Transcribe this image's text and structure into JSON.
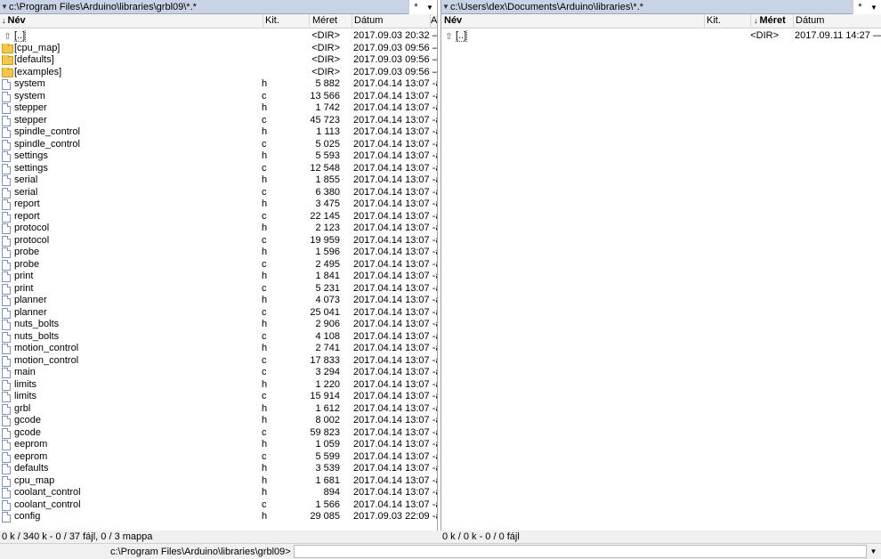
{
  "left": {
    "path": "c:\\Program Files\\Arduino\\libraries\\grbl09\\*.*",
    "headers": {
      "name": "Név",
      "ext": "Kit.",
      "size": "Méret",
      "date": "Dátum",
      "attr": "A"
    },
    "files": [
      {
        "icon": "up-icon",
        "name": "[..]",
        "ext": "",
        "size": "<DIR>",
        "date": "2017.09.03 20:32 —"
      },
      {
        "icon": "folder-icon",
        "name": "[cpu_map]",
        "ext": "",
        "size": "<DIR>",
        "date": "2017.09.03 09:56 —"
      },
      {
        "icon": "folder-icon",
        "name": "[defaults]",
        "ext": "",
        "size": "<DIR>",
        "date": "2017.09.03 09:56 —"
      },
      {
        "icon": "folder-icon",
        "name": "[examples]",
        "ext": "",
        "size": "<DIR>",
        "date": "2017.09.03 09:56 —"
      },
      {
        "icon": "file-icon",
        "name": "system",
        "ext": "h",
        "size": "5 882",
        "date": "2017.04.14 13:07 -a"
      },
      {
        "icon": "file-icon",
        "name": "system",
        "ext": "c",
        "size": "13 566",
        "date": "2017.04.14 13:07 -a"
      },
      {
        "icon": "file-icon",
        "name": "stepper",
        "ext": "h",
        "size": "1 742",
        "date": "2017.04.14 13:07 -a"
      },
      {
        "icon": "file-icon",
        "name": "stepper",
        "ext": "c",
        "size": "45 723",
        "date": "2017.04.14 13:07 -a"
      },
      {
        "icon": "file-icon",
        "name": "spindle_control",
        "ext": "h",
        "size": "1 113",
        "date": "2017.04.14 13:07 -a"
      },
      {
        "icon": "file-icon",
        "name": "spindle_control",
        "ext": "c",
        "size": "5 025",
        "date": "2017.04.14 13:07 -a"
      },
      {
        "icon": "file-icon",
        "name": "settings",
        "ext": "h",
        "size": "5 593",
        "date": "2017.04.14 13:07 -a"
      },
      {
        "icon": "file-icon",
        "name": "settings",
        "ext": "c",
        "size": "12 548",
        "date": "2017.04.14 13:07 -a"
      },
      {
        "icon": "file-icon",
        "name": "serial",
        "ext": "h",
        "size": "1 855",
        "date": "2017.04.14 13:07 -a"
      },
      {
        "icon": "file-icon",
        "name": "serial",
        "ext": "c",
        "size": "6 380",
        "date": "2017.04.14 13:07 -a"
      },
      {
        "icon": "file-icon",
        "name": "report",
        "ext": "h",
        "size": "3 475",
        "date": "2017.04.14 13:07 -a"
      },
      {
        "icon": "file-icon",
        "name": "report",
        "ext": "c",
        "size": "22 145",
        "date": "2017.04.14 13:07 -a"
      },
      {
        "icon": "file-icon",
        "name": "protocol",
        "ext": "h",
        "size": "2 123",
        "date": "2017.04.14 13:07 -a"
      },
      {
        "icon": "file-icon",
        "name": "protocol",
        "ext": "c",
        "size": "19 959",
        "date": "2017.04.14 13:07 -a"
      },
      {
        "icon": "file-icon",
        "name": "probe",
        "ext": "h",
        "size": "1 596",
        "date": "2017.04.14 13:07 -a"
      },
      {
        "icon": "file-icon",
        "name": "probe",
        "ext": "c",
        "size": "2 495",
        "date": "2017.04.14 13:07 -a"
      },
      {
        "icon": "file-icon",
        "name": "print",
        "ext": "h",
        "size": "1 841",
        "date": "2017.04.14 13:07 -a"
      },
      {
        "icon": "file-icon",
        "name": "print",
        "ext": "c",
        "size": "5 231",
        "date": "2017.04.14 13:07 -a"
      },
      {
        "icon": "file-icon",
        "name": "planner",
        "ext": "h",
        "size": "4 073",
        "date": "2017.04.14 13:07 -a"
      },
      {
        "icon": "file-icon",
        "name": "planner",
        "ext": "c",
        "size": "25 041",
        "date": "2017.04.14 13:07 -a"
      },
      {
        "icon": "file-icon",
        "name": "nuts_bolts",
        "ext": "h",
        "size": "2 906",
        "date": "2017.04.14 13:07 -a"
      },
      {
        "icon": "file-icon",
        "name": "nuts_bolts",
        "ext": "c",
        "size": "4 108",
        "date": "2017.04.14 13:07 -a"
      },
      {
        "icon": "file-icon",
        "name": "motion_control",
        "ext": "h",
        "size": "2 741",
        "date": "2017.04.14 13:07 -a"
      },
      {
        "icon": "file-icon",
        "name": "motion_control",
        "ext": "c",
        "size": "17 833",
        "date": "2017.04.14 13:07 -a"
      },
      {
        "icon": "file-icon",
        "name": "main",
        "ext": "c",
        "size": "3 294",
        "date": "2017.04.14 13:07 -a"
      },
      {
        "icon": "file-icon",
        "name": "limits",
        "ext": "h",
        "size": "1 220",
        "date": "2017.04.14 13:07 -a"
      },
      {
        "icon": "file-icon",
        "name": "limits",
        "ext": "c",
        "size": "15 914",
        "date": "2017.04.14 13:07 -a"
      },
      {
        "icon": "file-icon",
        "name": "grbl",
        "ext": "h",
        "size": "1 612",
        "date": "2017.04.14 13:07 -a"
      },
      {
        "icon": "file-icon",
        "name": "gcode",
        "ext": "h",
        "size": "8 002",
        "date": "2017.04.14 13:07 -a"
      },
      {
        "icon": "file-icon",
        "name": "gcode",
        "ext": "c",
        "size": "59 823",
        "date": "2017.04.14 13:07 -a"
      },
      {
        "icon": "file-icon",
        "name": "eeprom",
        "ext": "h",
        "size": "1 059",
        "date": "2017.04.14 13:07 -a"
      },
      {
        "icon": "file-icon",
        "name": "eeprom",
        "ext": "c",
        "size": "5 599",
        "date": "2017.04.14 13:07 -a"
      },
      {
        "icon": "file-icon",
        "name": "defaults",
        "ext": "h",
        "size": "3 539",
        "date": "2017.04.14 13:07 -a"
      },
      {
        "icon": "file-icon",
        "name": "cpu_map",
        "ext": "h",
        "size": "1 681",
        "date": "2017.04.14 13:07 -a"
      },
      {
        "icon": "file-icon",
        "name": "coolant_control",
        "ext": "h",
        "size": "894",
        "date": "2017.04.14 13:07 -a"
      },
      {
        "icon": "file-icon",
        "name": "coolant_control",
        "ext": "c",
        "size": "1 566",
        "date": "2017.04.14 13:07 -a"
      },
      {
        "icon": "file-icon",
        "name": "config",
        "ext": "h",
        "size": "29 085",
        "date": "2017.09.03 22:09 -a"
      }
    ],
    "status": "0 k / 340 k - 0 / 37 fájl, 0 / 3 mappa"
  },
  "right": {
    "path": "c:\\Users\\dex\\Documents\\Arduino\\libraries\\*.*",
    "headers": {
      "name": "Név",
      "ext": "Kit.",
      "size": "Méret",
      "date": "Dátum"
    },
    "files": [
      {
        "icon": "up-icon",
        "name": "[..]",
        "ext": "",
        "size": "<DIR>",
        "date": "2017.09.11 14:27 —"
      }
    ],
    "status": "0 k / 0 k - 0 / 0 fájl"
  },
  "cmdline": {
    "prompt": "c:\\Program Files\\Arduino\\libraries\\grbl09>",
    "value": ""
  },
  "symbols": {
    "star": "*",
    "dropdown": "▼",
    "sort_arrow": "↓"
  }
}
